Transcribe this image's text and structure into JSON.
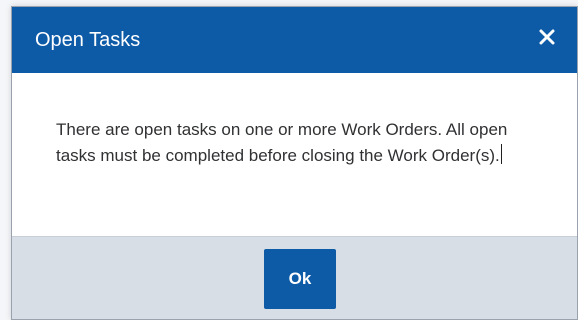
{
  "dialog": {
    "title": "Open Tasks",
    "close_icon": "close-icon",
    "message": "There are open tasks on one or more Work Orders. All open tasks must be completed before closing the Work Order(s).",
    "ok_label": "Ok"
  },
  "colors": {
    "header_bg": "#0d5aa7",
    "button_bg": "#0d5aa7",
    "footer_bg": "#d8dee6",
    "text": "#303133"
  }
}
